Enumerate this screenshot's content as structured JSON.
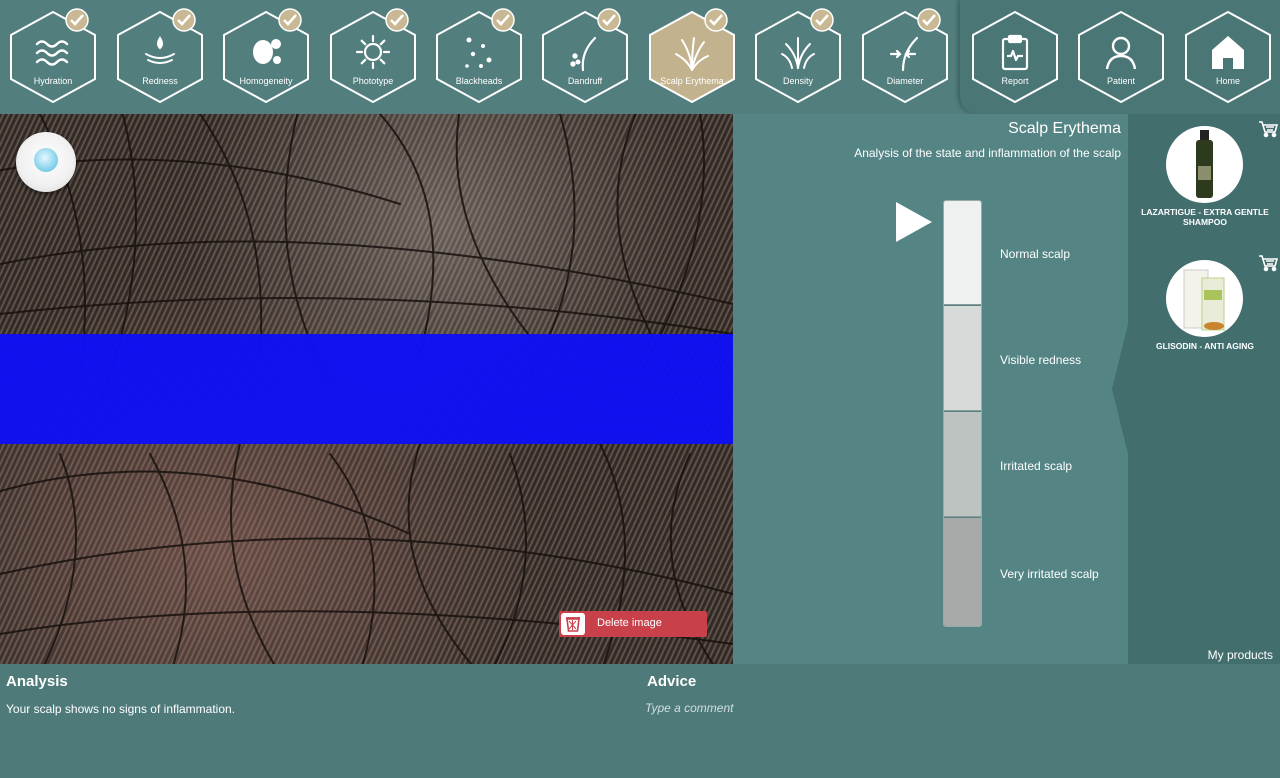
{
  "nav": {
    "items": [
      {
        "label": "Hydration",
        "icon": "waves-icon",
        "checked": true,
        "active": false
      },
      {
        "label": "Redness",
        "icon": "redness-icon",
        "checked": true,
        "active": false
      },
      {
        "label": "Homogeneity",
        "icon": "blobs-icon",
        "checked": true,
        "active": false
      },
      {
        "label": "Phototype",
        "icon": "sun-icon",
        "checked": true,
        "active": false
      },
      {
        "label": "Blackheads",
        "icon": "dots-icon",
        "checked": true,
        "active": false
      },
      {
        "label": "Dandruff",
        "icon": "hair-flakes-icon",
        "checked": true,
        "active": false
      },
      {
        "label": "Scalp Erythema",
        "icon": "hair-tuft-icon",
        "checked": true,
        "active": true
      },
      {
        "label": "Density",
        "icon": "grass-icon",
        "checked": true,
        "active": false
      },
      {
        "label": "Diameter",
        "icon": "hair-diameter-icon",
        "checked": true,
        "active": false
      }
    ],
    "right_items": [
      {
        "label": "Report",
        "icon": "clipboard-icon"
      },
      {
        "label": "Patient",
        "icon": "user-icon"
      },
      {
        "label": "Home",
        "icon": "home-icon"
      }
    ]
  },
  "image": {
    "delete_label": "Delete image",
    "drop_icon": "water-drop-icon"
  },
  "panel": {
    "title": "Scalp Erythema",
    "subtitle": "Analysis of the state and inflammation of the scalp",
    "scale": [
      {
        "label": "Normal scalp",
        "color": "#eef1ef"
      },
      {
        "label": "Visible redness",
        "color": "#d6dbd9"
      },
      {
        "label": "Irritated scalp",
        "color": "#bcc3c0"
      },
      {
        "label": "Very irritated scalp",
        "color": "#a6aaa9"
      }
    ],
    "selected_level": 0
  },
  "products": {
    "items": [
      {
        "name": "LAZARTIGUE  -  EXTRA GENTLE SHAMPOO"
      },
      {
        "name": "GLISODIN  -  ANTI AGING"
      }
    ],
    "my_products_label": "My products"
  },
  "bottom": {
    "analysis_heading": "Analysis",
    "analysis_text": "Your scalp shows no signs of inflammation.",
    "advice_heading": "Advice",
    "advice_placeholder": "Type a comment"
  },
  "colors": {
    "accent_active": "#c2b28e",
    "delete": "#c8404a",
    "band": "#1010f5"
  }
}
